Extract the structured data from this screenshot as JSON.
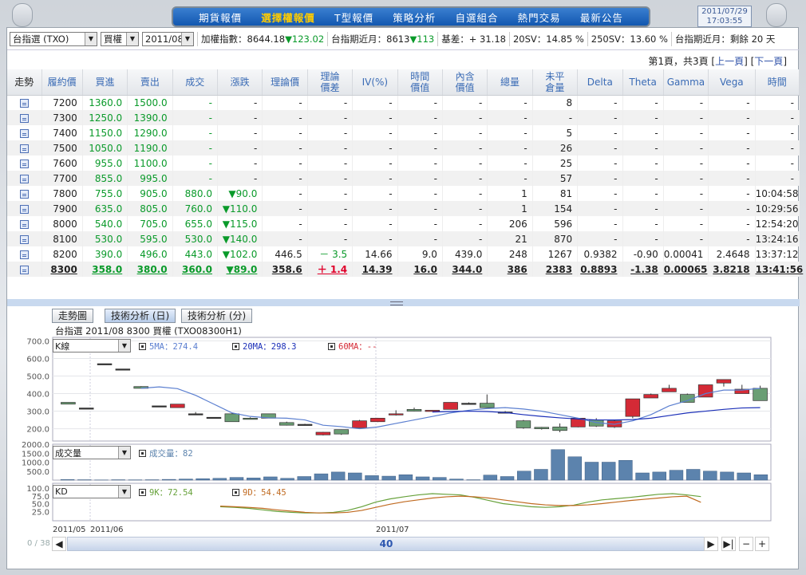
{
  "nav": {
    "items": [
      "期貨報價",
      "選擇權報價",
      "T型報價",
      "策略分析",
      "自選組合",
      "熱門交易",
      "最新公告"
    ],
    "active_index": 1
  },
  "clock": {
    "date": "2011/07/29",
    "time": "17:03:55"
  },
  "filters": {
    "product": "台指選 (TXO)",
    "type": "買權",
    "month": "2011/08"
  },
  "market": [
    {
      "label": "加權指數：",
      "value": "8644.18",
      "change": "▼123.02"
    },
    {
      "label": "台指期近月：",
      "value": "8613",
      "change": "▼113"
    },
    {
      "label": "基差：",
      "value": "+ 31.18",
      "change": ""
    },
    {
      "label": "20SV：",
      "value": "14.85 %",
      "change": ""
    },
    {
      "label": "250SV：",
      "value": "13.60 %",
      "change": ""
    },
    {
      "label": "台指期近月：",
      "value": "剩餘 20 天",
      "change": ""
    }
  ],
  "pager": {
    "text": "第1頁，共3頁",
    "prev": "上一頁",
    "next": "下一頁"
  },
  "table": {
    "headers": [
      "走勢",
      "履約價",
      "買進",
      "賣出",
      "成交",
      "漲跌",
      "理論價",
      "理論\n價差",
      "IV(%)",
      "時間\n價值",
      "內含\n價值",
      "總量",
      "未平\n倉量",
      "Delta",
      "Theta",
      "Gamma",
      "Vega",
      "時間"
    ],
    "rows": [
      [
        "",
        "7200",
        "1360.0",
        "1500.0",
        "-",
        "-",
        "-",
        "-",
        "-",
        "-",
        "-",
        "-",
        "8",
        "-",
        "-",
        "-",
        "-",
        "-"
      ],
      [
        "",
        "7300",
        "1250.0",
        "1390.0",
        "-",
        "-",
        "-",
        "-",
        "-",
        "-",
        "-",
        "-",
        "-",
        "-",
        "-",
        "-",
        "-",
        "-"
      ],
      [
        "",
        "7400",
        "1150.0",
        "1290.0",
        "-",
        "-",
        "-",
        "-",
        "-",
        "-",
        "-",
        "-",
        "5",
        "-",
        "-",
        "-",
        "-",
        "-"
      ],
      [
        "",
        "7500",
        "1050.0",
        "1190.0",
        "-",
        "-",
        "-",
        "-",
        "-",
        "-",
        "-",
        "-",
        "26",
        "-",
        "-",
        "-",
        "-",
        "-"
      ],
      [
        "",
        "7600",
        "955.0",
        "1100.0",
        "-",
        "-",
        "-",
        "-",
        "-",
        "-",
        "-",
        "-",
        "25",
        "-",
        "-",
        "-",
        "-",
        "-"
      ],
      [
        "",
        "7700",
        "855.0",
        "995.0",
        "-",
        "-",
        "-",
        "-",
        "-",
        "-",
        "-",
        "-",
        "57",
        "-",
        "-",
        "-",
        "-",
        "-"
      ],
      [
        "",
        "7800",
        "755.0",
        "905.0",
        "880.0",
        "▼90.0",
        "-",
        "-",
        "-",
        "-",
        "-",
        "1",
        "81",
        "-",
        "-",
        "-",
        "-",
        "10:04:58"
      ],
      [
        "",
        "7900",
        "635.0",
        "805.0",
        "760.0",
        "▼110.0",
        "-",
        "-",
        "-",
        "-",
        "-",
        "1",
        "154",
        "-",
        "-",
        "-",
        "-",
        "10:29:56"
      ],
      [
        "",
        "8000",
        "540.0",
        "705.0",
        "655.0",
        "▼115.0",
        "-",
        "-",
        "-",
        "-",
        "-",
        "206",
        "596",
        "-",
        "-",
        "-",
        "-",
        "12:54:20"
      ],
      [
        "",
        "8100",
        "530.0",
        "595.0",
        "530.0",
        "▼140.0",
        "-",
        "-",
        "-",
        "-",
        "-",
        "21",
        "870",
        "-",
        "-",
        "-",
        "-",
        "13:24:16"
      ],
      [
        "",
        "8200",
        "390.0",
        "496.0",
        "443.0",
        "▼102.0",
        "446.5",
        "－ 3.5",
        "14.66",
        "9.0",
        "439.0",
        "248",
        "1267",
        "0.9382",
        "-0.90",
        "0.00041",
        "2.4648",
        "13:37:12"
      ],
      [
        "",
        "8300",
        "358.0",
        "380.0",
        "360.0",
        "▼89.0",
        "358.6",
        "＋ 1.4",
        "14.39",
        "16.0",
        "344.0",
        "386",
        "2383",
        "0.8893",
        "-1.38",
        "0.00065",
        "3.8218",
        "13:41:56"
      ]
    ]
  },
  "tabs": [
    "走勢圖",
    "技術分析 (日)",
    "技術分析 (分)"
  ],
  "chart_title": "台指選 2011/08 8300 買權 (TXO08300H1)",
  "panels": {
    "k": "K線",
    "vol": "成交量",
    "kd": "KD"
  },
  "legends": {
    "ma5": "5MA：274.4",
    "ma20": "20MA：298.3",
    "ma60": "60MA：--",
    "vol": "成交量：82",
    "k9": "9K：72.54",
    "d9": "9D：54.45"
  },
  "scroll": {
    "pos": "0 / 38",
    "value": "40"
  },
  "colors": {
    "up": "#d42a36",
    "down": "#6a9e74",
    "ma5": "#5b7fd0",
    "ma20": "#1b2fb8",
    "vol": "#5c83ad",
    "k": "#c06a20",
    "d": "#66a13a"
  },
  "chart_data": [
    {
      "type": "candlestick",
      "title": "K線",
      "y_ticks": [
        "700.0",
        "600.0",
        "500.0",
        "400.0",
        "300.0",
        "200.0"
      ],
      "ylim": [
        130,
        720
      ],
      "x_labels": [
        "2011/05",
        "2011/06",
        "2011/07"
      ],
      "candles": [
        [
          350,
          340,
          350,
          340
        ],
        [
          318,
          318,
          318,
          318
        ],
        [
          570,
          570,
          570,
          570
        ],
        [
          540,
          540,
          540,
          540
        ],
        [
          440,
          430,
          442,
          430
        ],
        [
          330,
          330,
          330,
          330
        ],
        [
          320,
          340,
          340,
          320
        ],
        [
          285,
          285,
          295,
          280
        ],
        [
          265,
          265,
          265,
          265
        ],
        [
          285,
          240,
          290,
          240
        ],
        [
          260,
          255,
          265,
          255
        ],
        [
          285,
          260,
          285,
          260
        ],
        [
          235,
          220,
          240,
          218
        ],
        [
          225,
          225,
          228,
          222
        ],
        [
          165,
          180,
          182,
          162
        ],
        [
          195,
          170,
          196,
          165
        ],
        [
          205,
          245,
          250,
          205
        ],
        [
          240,
          260,
          262,
          238
        ],
        [
          280,
          285,
          305,
          275
        ],
        [
          310,
          300,
          320,
          298
        ],
        [
          300,
          305,
          305,
          300
        ],
        [
          310,
          350,
          350,
          310
        ],
        [
          345,
          345,
          350,
          340
        ],
        [
          345,
          320,
          395,
          320
        ],
        [
          295,
          295,
          300,
          290
        ],
        [
          245,
          205,
          250,
          200
        ],
        [
          208,
          200,
          210,
          195
        ],
        [
          210,
          190,
          230,
          180
        ],
        [
          210,
          260,
          262,
          208
        ],
        [
          250,
          215,
          260,
          210
        ],
        [
          210,
          245,
          250,
          205
        ],
        [
          270,
          370,
          370,
          260
        ],
        [
          375,
          395,
          400,
          375
        ],
        [
          410,
          430,
          450,
          410
        ],
        [
          395,
          350,
          400,
          350
        ],
        [
          380,
          450,
          450,
          380
        ],
        [
          460,
          480,
          480,
          440
        ],
        [
          400,
          425,
          450,
          400
        ],
        [
          430,
          360,
          445,
          360
        ]
      ],
      "ma5": [
        null,
        null,
        null,
        null,
        430,
        438,
        428,
        390,
        340,
        290,
        270,
        262,
        260,
        250,
        220,
        212,
        200,
        210,
        230,
        250,
        270,
        290,
        305,
        315,
        320,
        312,
        300,
        280,
        260,
        235,
        225,
        245,
        280,
        330,
        360,
        400,
        420,
        420,
        430
      ],
      "ma20": [
        null,
        null,
        null,
        null,
        null,
        null,
        null,
        null,
        null,
        null,
        null,
        null,
        null,
        null,
        null,
        null,
        null,
        null,
        null,
        null,
        295,
        298,
        300,
        298,
        292,
        280,
        270,
        262,
        255,
        250,
        250,
        252,
        260,
        275,
        290,
        300,
        310,
        318,
        320
      ]
    },
    {
      "type": "bar",
      "title": "成交量",
      "y_ticks": [
        "2000.0",
        "1500.0",
        "1000.0",
        "500.0"
      ],
      "ylim": [
        0,
        2000
      ],
      "values": [
        30,
        20,
        10,
        20,
        15,
        20,
        40,
        60,
        80,
        100,
        150,
        120,
        180,
        100,
        200,
        350,
        450,
        400,
        250,
        220,
        300,
        180,
        150,
        60,
        20,
        280,
        200,
        500,
        600,
        1700,
        1300,
        1000,
        1000,
        1100,
        400,
        450,
        550,
        600,
        500,
        450,
        400,
        300
      ]
    },
    {
      "type": "line",
      "title": "KD",
      "y_ticks": [
        "100.0",
        "75.0",
        "50.0",
        "25.0"
      ],
      "ylim": [
        0,
        100
      ],
      "k": [
        40,
        38,
        35,
        30,
        25,
        22,
        20,
        20,
        22,
        28,
        40,
        55,
        65,
        72,
        78,
        82,
        80,
        78,
        70,
        60,
        50,
        45,
        40,
        38,
        40,
        45,
        55,
        62,
        66,
        70,
        75,
        80,
        82,
        78,
        72.54
      ],
      "d": [
        42,
        40,
        38,
        35,
        30,
        26,
        22,
        20,
        20,
        22,
        28,
        38,
        48,
        56,
        62,
        68,
        72,
        74,
        72,
        68,
        62,
        56,
        50,
        46,
        44,
        44,
        46,
        50,
        55,
        60,
        64,
        68,
        72,
        74,
        54.45
      ]
    }
  ]
}
